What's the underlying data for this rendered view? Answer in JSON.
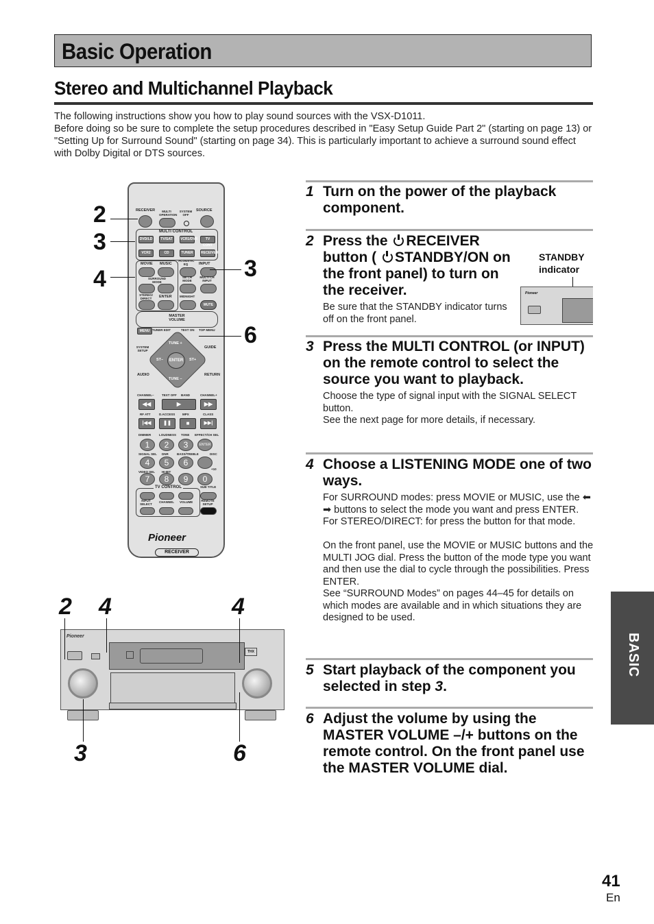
{
  "section_banner": "Basic Operation",
  "page_title": "Stereo and Multichannel Playback",
  "intro": [
    "The following instructions show you how to play sound sources with the VSX-D1011.",
    "Before doing so be sure to complete the setup procedures described in \"Easy Setup Guide Part 2\" (starting on page 13) or \"Setting Up for Surround Sound\" (starting on page 34). This is particularly important to achieve a surround sound effect with Dolby Digital or DTS sources."
  ],
  "steps": [
    {
      "num": "1",
      "heading": "Turn on the power of the playback component.",
      "body": []
    },
    {
      "num": "2",
      "heading_parts": [
        "Press the",
        "RECEIVER button (",
        "STANDBY/ON on the front panel) to turn on the receiver."
      ],
      "body": [
        "Be sure that the STANDBY indicator turns off on the front panel."
      ]
    },
    {
      "num": "3",
      "heading": "Press the MULTI CONTROL (or INPUT) on the remote control to select the source you want to playback.",
      "body": [
        "Choose the type of signal input with the SIGNAL SELECT button.",
        "See the next page for more details, if necessary."
      ]
    },
    {
      "num": "4",
      "heading": "Choose a LISTENING MODE one of two ways.",
      "body": [
        "For SURROUND modes: press MOVIE or MUSIC, use the ⬅ ➡ buttons to select the mode you want and press ENTER.",
        "For STEREO/DIRECT: for press the button for that mode.",
        "",
        "On the front panel, use the MOVIE or MUSIC buttons and the MULTI JOG dial. Press the button of the mode type you want and then use the dial to cycle through the possibilities. Press ENTER.",
        "See “SURROUND Modes” on  pages 44–45 for details on which modes are available and in which situations they are designed to be used."
      ]
    },
    {
      "num": "5",
      "heading_parts": [
        "Start playback of the component you selected in step",
        "3",
        "."
      ],
      "body": []
    },
    {
      "num": "6",
      "heading": "Adjust the volume by using the MASTER VOLUME –/+ buttons on the remote control. On the front panel use the MASTER VOLUME dial.",
      "body": []
    }
  ],
  "standby_label": [
    "STANDBY",
    "indicator"
  ],
  "side_tab": "BASIC",
  "page_number": "41",
  "page_lang": "En",
  "remote_callouts": {
    "left": [
      "2",
      "3",
      "4"
    ],
    "right": [
      "3",
      "6"
    ]
  },
  "receiver_callouts": {
    "top": [
      "2",
      "4",
      "4"
    ],
    "bottom": [
      "3",
      "6"
    ]
  },
  "remote": {
    "receiver": "RECEIVER",
    "multi_operation": "MULTI OPERATION",
    "system_off": "SYSTEM OFF",
    "source": "SOURCE",
    "multi_control": "MULTI CONTROL",
    "sources_row1": [
      "DVD/LD",
      "TV/SAT",
      "VCR1/DVR",
      "TV CONT"
    ],
    "sources_row2": [
      "VCR2",
      "CD",
      "TUNER",
      "RECEIVER"
    ],
    "movie": "MOVIE",
    "music": "MUSIC",
    "acoustic_eq": "ACOUSTIC EQ",
    "input": "INPUT",
    "surround_mode": "SURROUND MODE",
    "sb_ch_mode": "SB CH MODE",
    "multi_ch_input": "MULTI CH INPUT",
    "stereo_direct": "STEREO/ DIRECT",
    "enter": "ENTER",
    "midnight": "MIDNIGHT",
    "mute": "MUTE",
    "master_volume": "MASTER VOLUME",
    "menu": "MENU",
    "tuner_edit": "TUNER EDIT",
    "text_on": "TEXT ON",
    "top_menu": "TOP MENU",
    "system_setup": "SYSTEM SETUP",
    "guide": "GUIDE",
    "tune_plus": "TUNE +",
    "tune_minus": "TUNE –",
    "st_minus": "ST–",
    "st_plus": "ST+",
    "audio": "AUDIO",
    "return": "RETURN",
    "channel_minus": "CHANNEL–",
    "text_off": "TEXT OFF",
    "band": "BAND",
    "channel_plus": "CHANNEL+",
    "rf_att": "RF ATT",
    "d_access": "D.ACCESS",
    "mpx": "MPX",
    "class": "CLASS",
    "num_labels": [
      "DIMMER",
      "LOUDNESS",
      "TONE",
      "EFFECT/CH SEL",
      "SIGNAL SEL",
      "DNR",
      "BASS/TREBLE",
      "DISC",
      "VIDEO SEL",
      "HI-BIT",
      "+10"
    ],
    "digits": [
      "1",
      "2",
      "3",
      "4",
      "5",
      "6",
      "7",
      "8",
      "9",
      "0"
    ],
    "tv_control": "TV CONTROL",
    "subtitle": "SUB TITLE",
    "input_select": "INPUT SELECT",
    "channel": "CHANNEL",
    "volume": "VOLUME",
    "remote_setup": "REMOTE SETUP",
    "brand": "Pioneer",
    "bottom_label": "RECEIVER"
  }
}
